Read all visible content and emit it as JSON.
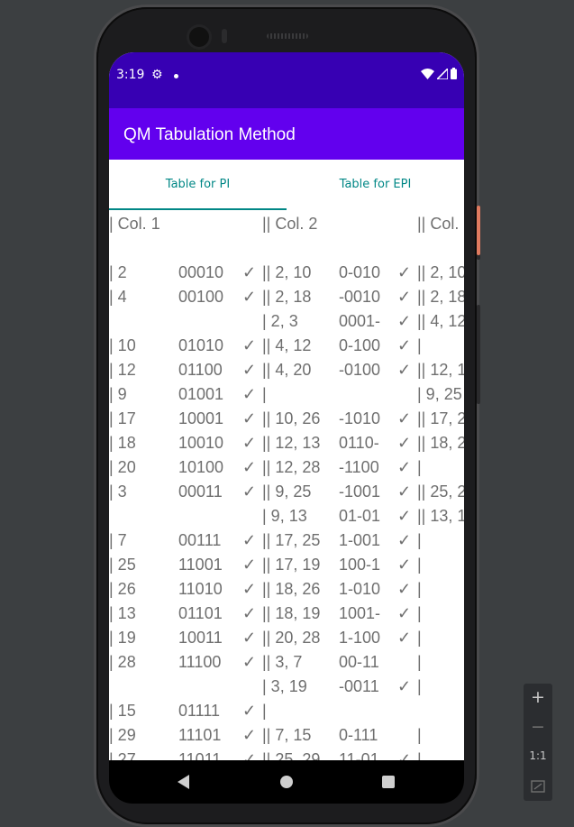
{
  "status_bar": {
    "time": "3:19",
    "colors": {
      "status": "#3700b3",
      "appbar": "#6200ee",
      "accent": "#018786"
    }
  },
  "app_bar": {
    "title": "QM Tabulation Method"
  },
  "tabs": [
    {
      "label": "Table for PI"
    },
    {
      "label": "Table for EPI"
    }
  ],
  "table": {
    "headers": [
      "| Col. 1",
      "|| Col. 2",
      "|| Col."
    ],
    "rows": [
      [
        "| 2",
        "00010",
        "✓",
        "|| 2, 10",
        "0-010",
        "✓",
        "|| 2, 10"
      ],
      [
        "| 4",
        "00100",
        "✓",
        "|| 2, 18",
        "-0010",
        "✓",
        "|| 2, 18"
      ],
      [
        "",
        "",
        "",
        "| 2, 3",
        "0001-",
        "✓",
        "|| 4, 12"
      ],
      [
        "| 10",
        "01010",
        "✓",
        "|| 4, 12",
        "0-100",
        "✓",
        "|"
      ],
      [
        "| 12",
        "01100",
        "✓",
        "|| 4, 20",
        "-0100",
        "✓",
        "|| 12, 1"
      ],
      [
        "| 9",
        "01001",
        "✓",
        "|",
        "",
        "",
        "| 9, 25"
      ],
      [
        "| 17",
        "10001",
        "✓",
        "|| 10, 26",
        "-1010",
        "✓",
        "|| 17, 2"
      ],
      [
        "| 18",
        "10010",
        "✓",
        "|| 12, 13",
        "0110-",
        "✓",
        "|| 18, 2"
      ],
      [
        "| 20",
        "10100",
        "✓",
        "|| 12, 28",
        "-1100",
        "✓",
        "|"
      ],
      [
        "| 3",
        "00011",
        "✓",
        "|| 9, 25",
        "-1001",
        "✓",
        "|| 25, 2"
      ],
      [
        "",
        "",
        "",
        "| 9, 13",
        "01-01",
        "✓",
        "|| 13, 1"
      ],
      [
        "| 7",
        "00111",
        "✓",
        "|| 17, 25",
        "1-001",
        "✓",
        "|"
      ],
      [
        "| 25",
        "11001",
        "✓",
        "|| 17, 19",
        "100-1",
        "✓",
        "|"
      ],
      [
        "| 26",
        "11010",
        "✓",
        "|| 18, 26",
        "1-010",
        "✓",
        "|"
      ],
      [
        "| 13",
        "01101",
        "✓",
        "|| 18, 19",
        "1001-",
        "✓",
        "|"
      ],
      [
        "| 19",
        "10011",
        "✓",
        "|| 20, 28",
        "1-100",
        "✓",
        "|"
      ],
      [
        "| 28",
        "11100",
        "✓",
        "|| 3, 7",
        "00-11",
        "",
        "|"
      ],
      [
        "",
        "",
        "",
        "| 3, 19",
        "-0011",
        "✓",
        "|"
      ],
      [
        "| 15",
        "01111",
        "✓",
        "|",
        "",
        "",
        ""
      ],
      [
        "| 29",
        "11101",
        "✓",
        "|| 7, 15",
        "0-111",
        "",
        "|"
      ],
      [
        "| 27",
        "11011",
        "✓",
        "|| 25, 29",
        "11-01",
        "✓",
        "|"
      ]
    ]
  },
  "emulator_toolbar": {
    "zoom_in": "+",
    "zoom_out": "−",
    "actual_size": "1:1"
  }
}
